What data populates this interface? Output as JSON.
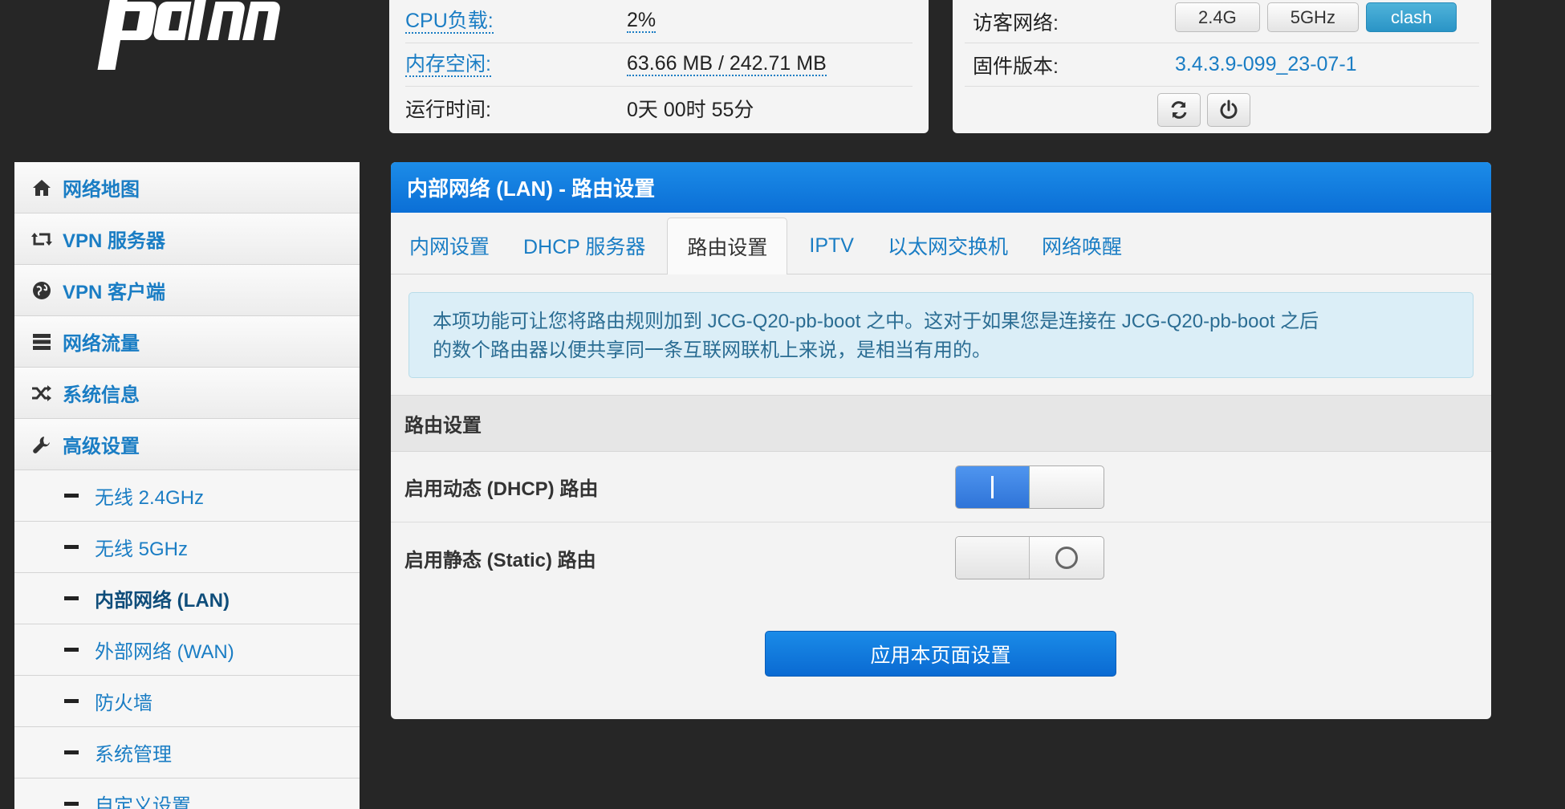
{
  "colors": {
    "accent": "#1a7dc4",
    "header_blue": "#0b6fd6",
    "background": "#262626"
  },
  "logo": {
    "icon": "padavan-logo",
    "text": "pdn"
  },
  "status": {
    "cpu_label": "CPU负载:",
    "cpu_value": "2%",
    "mem_label": "内存空闲:",
    "mem_value": "63.66 MB / 242.71 MB",
    "uptime_label": "运行时间:",
    "uptime_value": "0天 00时 55分",
    "guest_label": "访客网络:",
    "guest_buttons": [
      "2.4G",
      "5GHz",
      "clash"
    ],
    "guest_active": "clash",
    "firmware_label": "固件版本:",
    "firmware_value": "3.4.3.9-099_23-07-1",
    "icons": [
      "refresh-icon",
      "power-icon"
    ]
  },
  "sidebar": {
    "items": [
      {
        "label": "网络地图",
        "icon": "home-icon"
      },
      {
        "label": "VPN 服务器",
        "icon": "retweet-icon"
      },
      {
        "label": "VPN 客户端",
        "icon": "globe-icon"
      },
      {
        "label": "网络流量",
        "icon": "list-icon"
      },
      {
        "label": "系统信息",
        "icon": "shuffle-icon"
      },
      {
        "label": "高级设置",
        "icon": "wrench-icon"
      }
    ],
    "subitems": [
      {
        "label": "无线 2.4GHz"
      },
      {
        "label": "无线 5GHz"
      },
      {
        "label": "内部网络 (LAN)"
      },
      {
        "label": "外部网络 (WAN)"
      },
      {
        "label": "防火墙"
      },
      {
        "label": "系统管理"
      },
      {
        "label": "自定义设置"
      }
    ],
    "current": "内部网络 (LAN)"
  },
  "main": {
    "title": "内部网络 (LAN) - 路由设置",
    "tabs": [
      "内网设置",
      "DHCP 服务器",
      "路由设置",
      "IPTV",
      "以太网交换机",
      "网络唤醒"
    ],
    "active_tab": "路由设置",
    "info_line1": "本项功能可让您将路由规则加到 JCG-Q20-pb-boot 之中。这对于如果您是连接在 JCG-Q20-pb-boot 之后",
    "info_line2": "的数个路由器以便共享同一条互联网联机上来说，是相当有用的。",
    "section_title": "路由设置",
    "rows": [
      {
        "label": "启用动态 (DHCP) 路由",
        "enabled": true
      },
      {
        "label": "启用静态 (Static) 路由",
        "enabled": false
      }
    ],
    "apply_label": "应用本页面设置"
  }
}
